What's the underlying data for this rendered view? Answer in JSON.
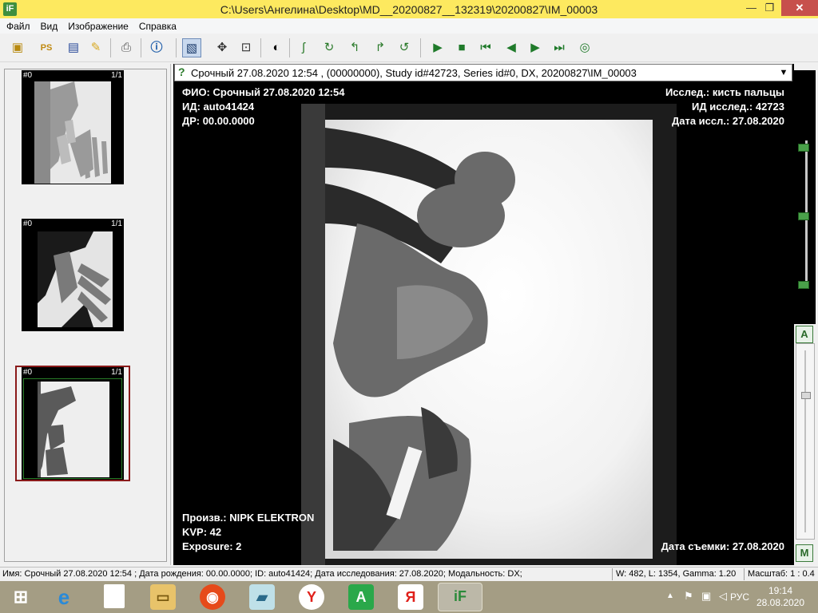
{
  "window": {
    "title": "C:\\Users\\Ангелина\\Desktop\\MD__20200827__132319\\20200827\\IM_00003",
    "app_icon_label": "iF"
  },
  "menu": [
    "Файл",
    "Вид",
    "Изображение",
    "Справка"
  ],
  "toolbar_icons": [
    "open-folder-icon",
    "ps-open-icon",
    "save-icon",
    "notes-icon",
    "print-icon",
    "info-icon",
    "image-info-icon",
    "move-icon",
    "fit-icon",
    "invert-icon",
    "magic-tool-icon",
    "rotate-icon",
    "rotate-left-icon",
    "rotate-right-icon",
    "undo-icon",
    "play-icon",
    "stop-icon",
    "first-icon",
    "prev-icon",
    "next-icon",
    "last-icon",
    "cine-icon"
  ],
  "thumbnails": [
    {
      "id": "#0",
      "count": "1/1"
    },
    {
      "id": "#0",
      "count": "1/1"
    },
    {
      "id": "#0",
      "count": "1/1",
      "selected": true
    }
  ],
  "series_combo": "Срочный 27.08.2020 12:54 , (00000000), Study id#42723, Series id#0, DX, 20200827\\IM_00003",
  "overlay": {
    "tl1": "ФИО: Срочный 27.08.2020 12:54",
    "tl2": "ИД: auto41424",
    "tl3": "ДР: 00.00.0000",
    "tr1": "Исслед.: кисть пальцы",
    "tr2": "ИД исслед.: 42723",
    "tr3": "Дата иссл.: 27.08.2020",
    "bl1": "Произв.: NIPK ELEKTRON",
    "bl2": "KVP: 42",
    "bl3": "Exposure: 2",
    "br1": "Дата съемки: 27.08.2020"
  },
  "status": {
    "left": "Имя: Срочный 27.08.2020 12:54 ; Дата рождения: 00.00.0000; ID: auto41424; Дата исследования: 27.08.2020; Модальность: DX;",
    "wl": "W: 482, L: 1354, Gamma: 1.20",
    "scale": "Масштаб: 1 : 0.4"
  },
  "taskbar": {
    "lang": "РУС",
    "time": "19:14",
    "date": "28.08.2020"
  },
  "colors": {
    "title_bar": "#fde95f",
    "taskbar": "#a49d84",
    "close": "#c7504c"
  }
}
